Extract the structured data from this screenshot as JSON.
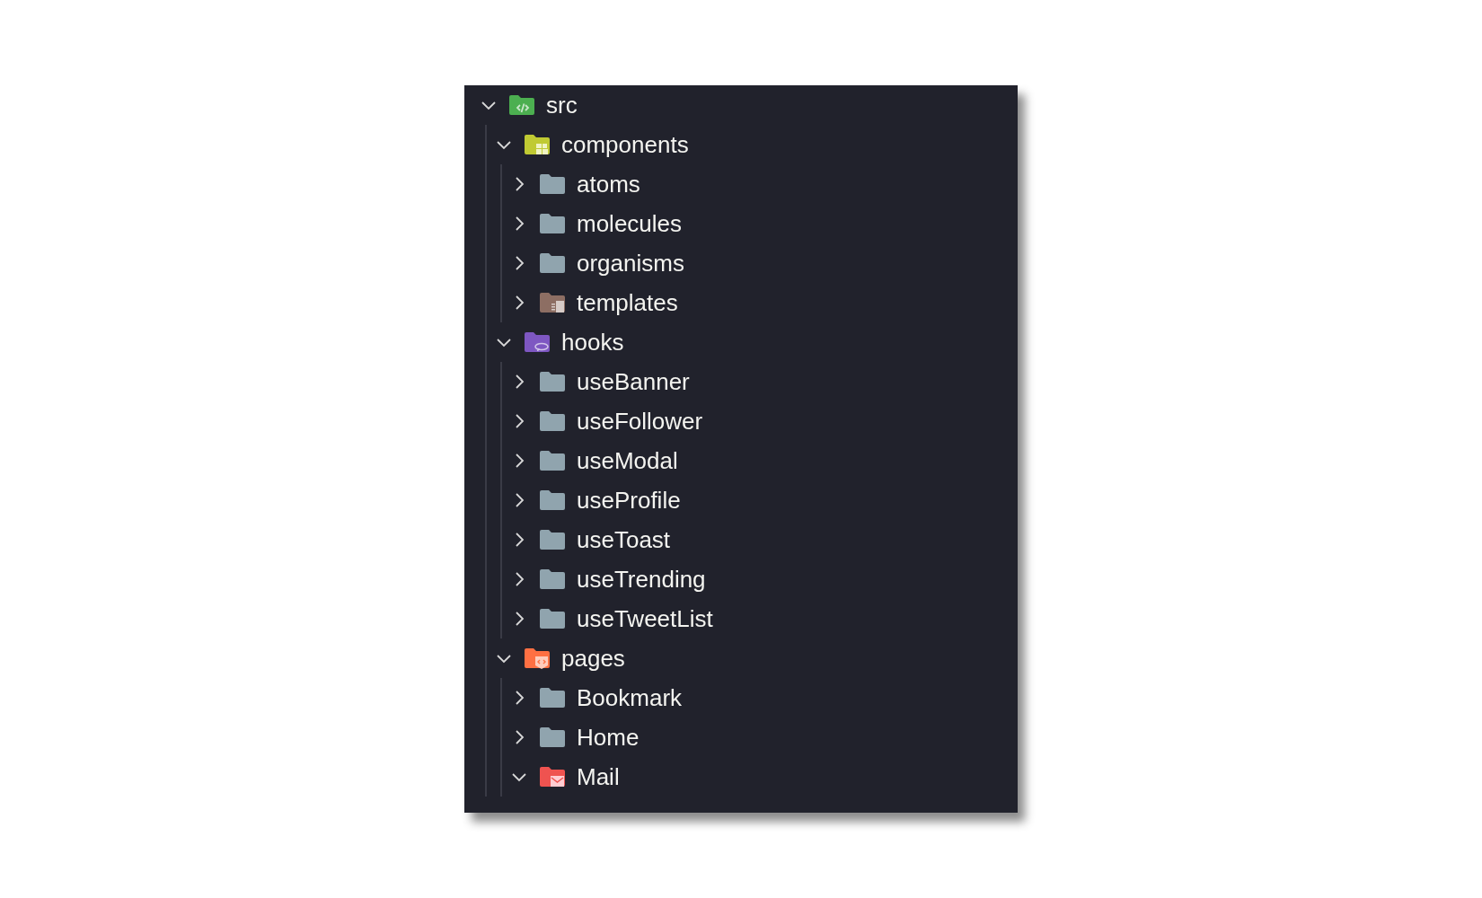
{
  "tree": [
    {
      "name": "src",
      "kind": "src",
      "expanded": true,
      "children": [
        {
          "name": "components",
          "kind": "components",
          "expanded": true,
          "children": [
            {
              "name": "atoms",
              "kind": "plain",
              "expanded": false
            },
            {
              "name": "molecules",
              "kind": "plain",
              "expanded": false
            },
            {
              "name": "organisms",
              "kind": "plain",
              "expanded": false
            },
            {
              "name": "templates",
              "kind": "templates",
              "expanded": false
            }
          ]
        },
        {
          "name": "hooks",
          "kind": "hooks",
          "expanded": true,
          "children": [
            {
              "name": "useBanner",
              "kind": "plain",
              "expanded": false
            },
            {
              "name": "useFollower",
              "kind": "plain",
              "expanded": false
            },
            {
              "name": "useModal",
              "kind": "plain",
              "expanded": false
            },
            {
              "name": "useProfile",
              "kind": "plain",
              "expanded": false
            },
            {
              "name": "useToast",
              "kind": "plain",
              "expanded": false
            },
            {
              "name": "useTrending",
              "kind": "plain",
              "expanded": false
            },
            {
              "name": "useTweetList",
              "kind": "plain",
              "expanded": false
            }
          ]
        },
        {
          "name": "pages",
          "kind": "pages",
          "expanded": true,
          "children": [
            {
              "name": "Bookmark",
              "kind": "plain",
              "expanded": false
            },
            {
              "name": "Home",
              "kind": "plain",
              "expanded": false
            },
            {
              "name": "Mail",
              "kind": "mail",
              "expanded": true
            }
          ]
        }
      ]
    }
  ]
}
